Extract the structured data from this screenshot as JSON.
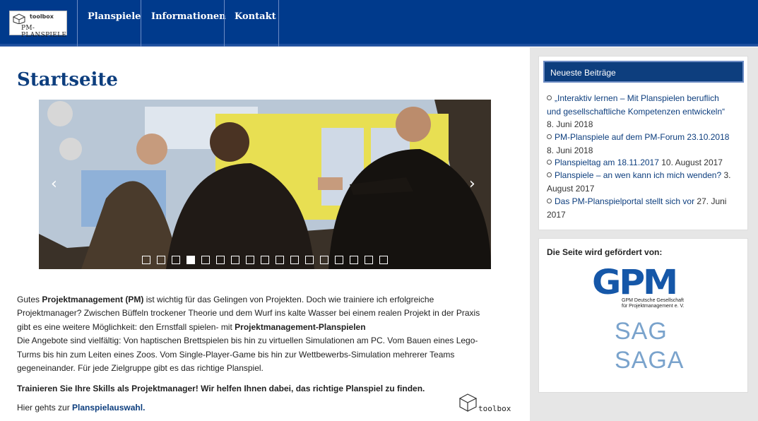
{
  "logo": {
    "line1": "toolbox",
    "line2": "PM-PLANSPIELE"
  },
  "nav": {
    "items": [
      {
        "label": "Planspiele"
      },
      {
        "label": "Informationen"
      },
      {
        "label": "Kontakt"
      }
    ]
  },
  "page": {
    "title": "Startseite"
  },
  "slider": {
    "prev": "‹",
    "next": "›",
    "slide_count": 17,
    "active_index": 3
  },
  "content": {
    "p1_a": "Gutes ",
    "p1_b": "Projektmanagement (PM)",
    "p1_c": " ist wichtig für das Gelingen von Projekten. Doch wie trainiere ich erfolgreiche",
    "p2": "Projektmanager? Zwischen Büffeln trockener Theorie und dem Wurf ins kalte Wasser bei einem realen Projekt in der Praxis",
    "p3_a": "gibt es eine weitere Möglichkeit: den Ernstfall spielen- mit ",
    "p3_b": "Projektmanagement-Planspielen",
    "p4": "Die Angebote sind vielfältig: Von haptischen Brettspielen bis hin zu virtuellen Simulationen am PC. Vom Bauen eines Lego-",
    "p5": "Turms bis hin zum Leiten eines Zoos. Vom Single-Player-Game bis hin zur Wettbewerbs-Simulation mehrerer Teams",
    "p6": "gegeneinander. Für jede Zielgruppe gibt es das richtige Planspiel.",
    "bold_line": "Trainieren Sie Ihre Skills als Projektmanager! Wir helfen Ihnen dabei, das richtige Planspiel zu finden.",
    "link_pre": "Hier gehts zur ",
    "link_label": "Planspielauswahl.",
    "footer_logo": "toolbox"
  },
  "sidebar": {
    "news_title": "Neueste Beiträge",
    "news": [
      {
        "title": "„Interaktiv lernen – Mit Planspielen beruflich",
        "title2": "und gesellschaftliche Kompetenzen entwickeln“",
        "date": "8. Juni 2018"
      },
      {
        "title": "PM-Planspiele auf dem PM-Forum 23.10.2018",
        "date": "8. Juni 2018"
      },
      {
        "title": "Planspieltag am 18.11.2017",
        "date": "10. August 2017"
      },
      {
        "title": "Planspiele – an wen kann ich mich wenden?",
        "date": "3.",
        "date2": "August 2017"
      },
      {
        "title": "Das PM-Planspielportal stellt sich vor",
        "date": "27. Juni",
        "date2": "2017"
      }
    ],
    "sponsor_title": "Die Seite wird gefördert von:",
    "gpm": {
      "name": "GPM",
      "line1": "GPM Deutsche Gesellschaft",
      "line2": "für Projektmanagement e. V."
    },
    "saga": {
      "line1": "SAG",
      "line2": "SAGA"
    }
  },
  "colors": {
    "brand": "#0d3e7e",
    "nav": "#003a8c"
  }
}
